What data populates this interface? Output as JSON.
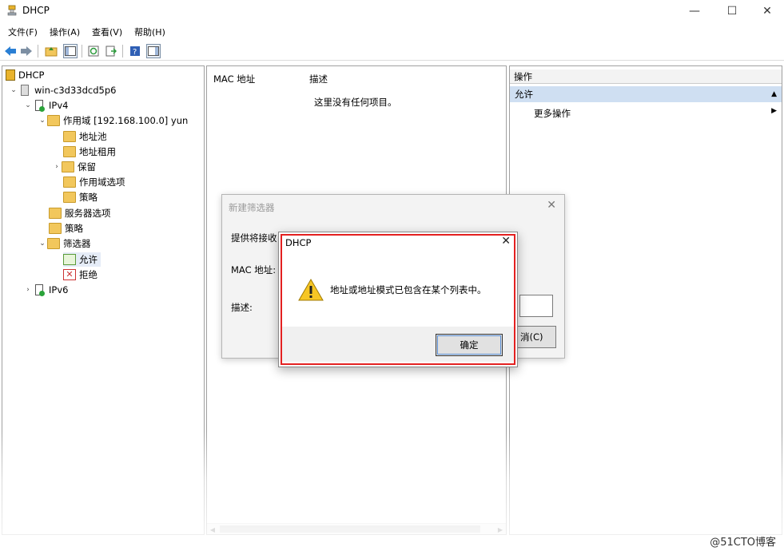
{
  "window": {
    "title": "DHCP",
    "minimize": "—",
    "maximize": "☐",
    "close": "✕"
  },
  "menu": [
    "文件(F)",
    "操作(A)",
    "查看(V)",
    "帮助(H)"
  ],
  "tree": {
    "root": "DHCP",
    "server": "win-c3d33dcd5p6",
    "ipv4": "IPv4",
    "scope": "作用域 [192.168.100.0] yun",
    "address_pool": "地址池",
    "address_leases": "地址租用",
    "reservations": "保留",
    "scope_options": "作用域选项",
    "scope_policies": "策略",
    "server_options": "服务器选项",
    "policies": "策略",
    "filters": "筛选器",
    "allow": "允许",
    "deny": "拒绝",
    "ipv6": "IPv6"
  },
  "list": {
    "columns": [
      "MAC 地址",
      "描述"
    ],
    "empty": "这里没有任何项目。"
  },
  "actions": {
    "header": "操作",
    "section": "允许",
    "more": "更多操作"
  },
  "bg_dialog": {
    "title": "新建筛选器",
    "label1": "提供将接收",
    "label_mac": "MAC 地址:",
    "label_desc": "描述:",
    "button": "消(C)"
  },
  "alert": {
    "title": "DHCP",
    "close": "✕",
    "message": "地址或地址模式已包含在某个列表中。",
    "ok": "确定"
  },
  "watermark": "@51CTO博客"
}
